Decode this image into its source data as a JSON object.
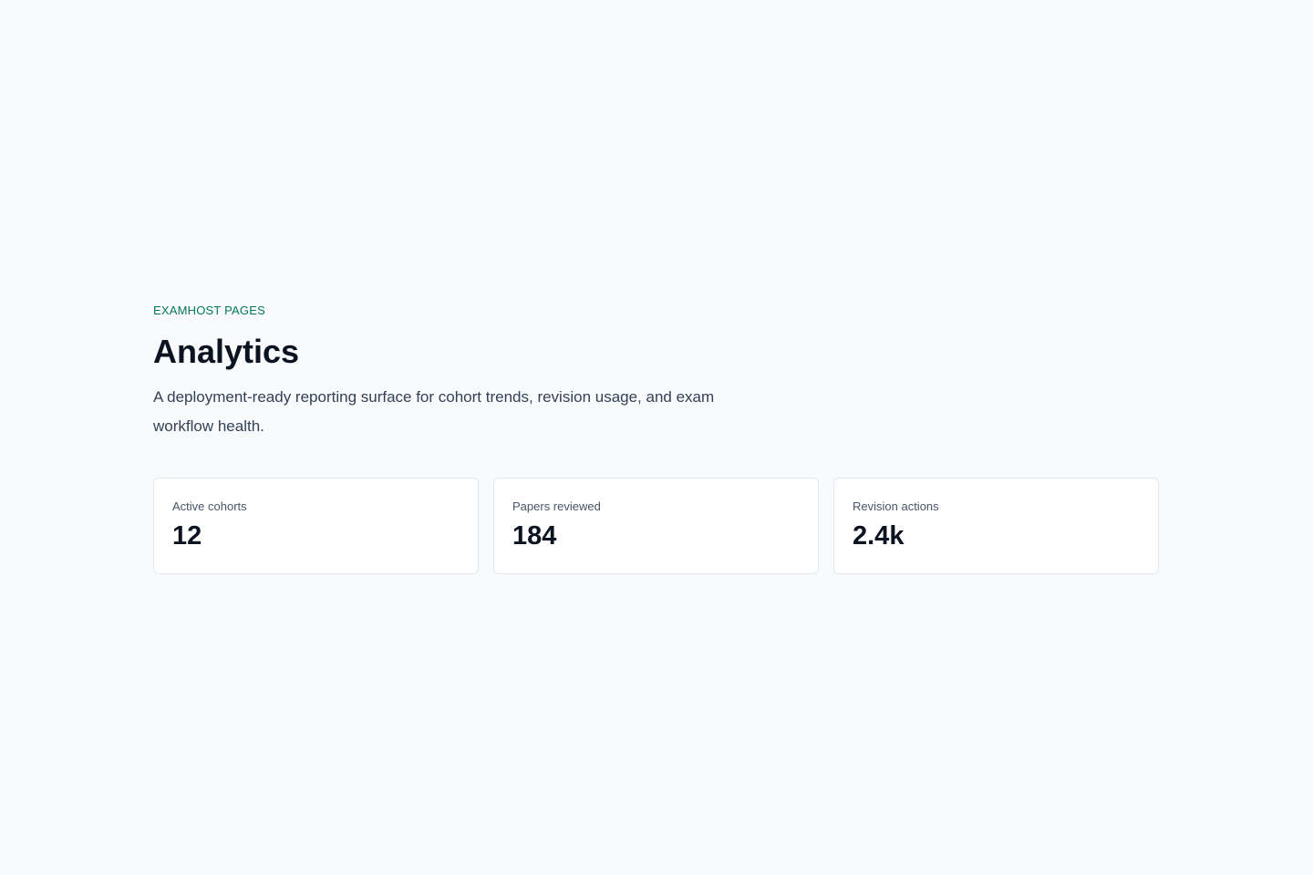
{
  "header": {
    "eyebrow": "EXAMHOST PAGES",
    "title": "Analytics",
    "description": "A deployment-ready reporting surface for cohort trends, revision usage, and exam workflow health."
  },
  "stats": [
    {
      "label": "Active cohorts",
      "value": "12"
    },
    {
      "label": "Papers reviewed",
      "value": "184"
    },
    {
      "label": "Revision actions",
      "value": "2.4k"
    }
  ],
  "colors": {
    "accent": "#047857",
    "background": "#f8fafc",
    "card": "#ffffff",
    "border": "#e2e8f0"
  }
}
